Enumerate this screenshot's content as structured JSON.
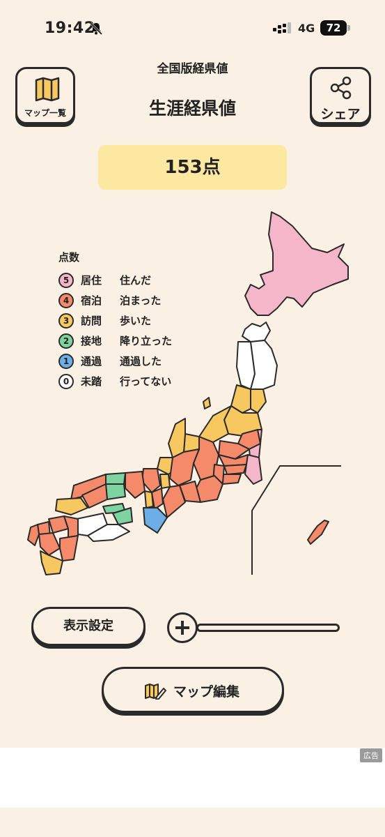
{
  "status": {
    "time": "19:42",
    "network": "4G",
    "battery": "72"
  },
  "header": {
    "subtitle": "全国版経県値",
    "title": "生涯経県値",
    "map_list_label": "マップ一覧",
    "share_label": "シェア"
  },
  "score": {
    "value": "153点"
  },
  "legend": {
    "title": "点数",
    "items": [
      {
        "num": "5",
        "name": "居住",
        "desc": "住んだ",
        "color": "#f4b6c8"
      },
      {
        "num": "4",
        "name": "宿泊",
        "desc": "泊まった",
        "color": "#f48a6a"
      },
      {
        "num": "3",
        "name": "訪問",
        "desc": "歩いた",
        "color": "#f8c860"
      },
      {
        "num": "2",
        "name": "接地",
        "desc": "降り立った",
        "color": "#7fd3a0"
      },
      {
        "num": "1",
        "name": "通過",
        "desc": "通過した",
        "color": "#6eaee6"
      },
      {
        "num": "0",
        "name": "未踏",
        "desc": "行ってない",
        "color": "#ffffff"
      }
    ]
  },
  "controls": {
    "display_settings_label": "表示設定",
    "edit_map_label": "マップ編集"
  },
  "ad": {
    "badge": "広告"
  }
}
